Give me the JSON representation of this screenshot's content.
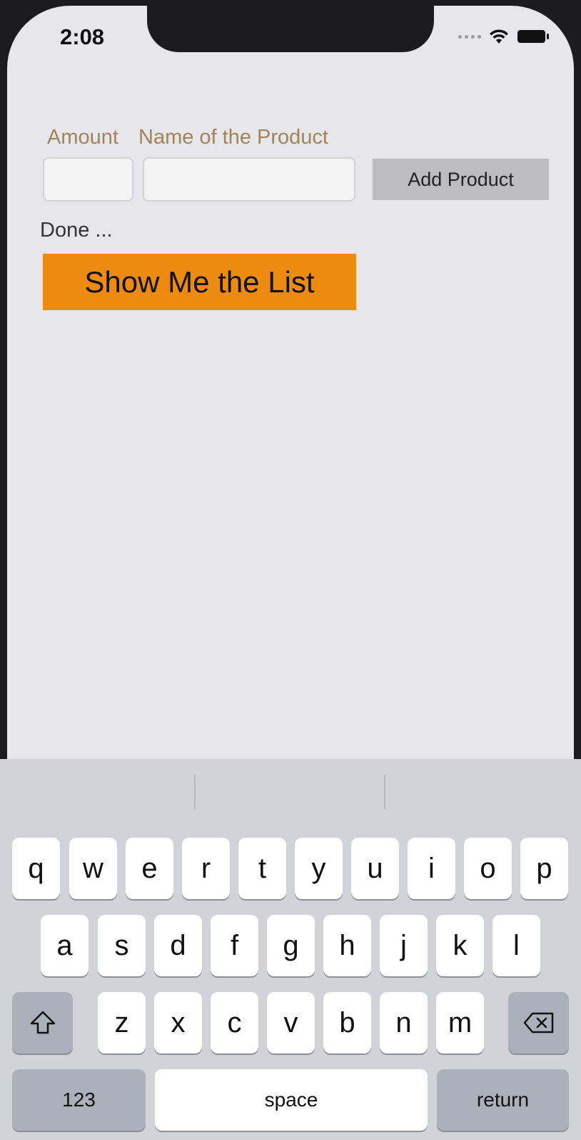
{
  "status_bar": {
    "time": "2:08"
  },
  "form": {
    "amount_label": "Amount",
    "name_label": "Name of the Product",
    "amount_value": "",
    "name_value": "",
    "add_button_label": "Add Product",
    "status_text": "Done ...",
    "show_list_button_label": "Show Me the List"
  },
  "keyboard": {
    "row1": [
      "q",
      "w",
      "e",
      "r",
      "t",
      "y",
      "u",
      "i",
      "o",
      "p"
    ],
    "row2": [
      "a",
      "s",
      "d",
      "f",
      "g",
      "h",
      "j",
      "k",
      "l"
    ],
    "row3": [
      "z",
      "x",
      "c",
      "v",
      "b",
      "n",
      "m"
    ],
    "numbers_key": "123",
    "space_key": "space",
    "return_key": "return"
  },
  "colors": {
    "accent_orange": "#ed8b11",
    "label_tan": "#a1845c",
    "background": "#e7e6eb"
  }
}
